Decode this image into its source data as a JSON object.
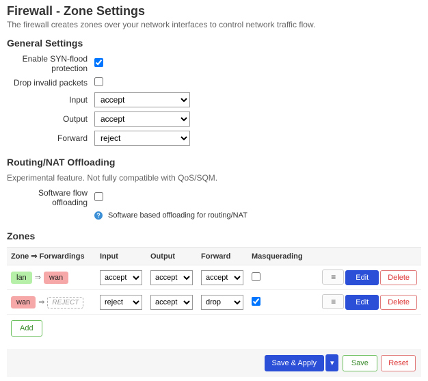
{
  "page": {
    "title": "Firewall - Zone Settings",
    "subtitle": "The firewall creates zones over your network interfaces to control network traffic flow."
  },
  "general": {
    "heading": "General Settings",
    "syn_flood_label": "Enable SYN-flood protection",
    "syn_flood_checked": true,
    "drop_invalid_label": "Drop invalid packets",
    "drop_invalid_checked": false,
    "input_label": "Input",
    "input_value": "accept",
    "output_label": "Output",
    "output_value": "accept",
    "forward_label": "Forward",
    "forward_value": "reject"
  },
  "offloading": {
    "heading": "Routing/NAT Offloading",
    "subtitle": "Experimental feature. Not fully compatible with QoS/SQM.",
    "software_label": "Software flow offloading",
    "software_checked": false,
    "hint": "Software based offloading for routing/NAT"
  },
  "zones": {
    "heading": "Zones",
    "columns": {
      "zone_fwd": "Zone ⇒ Forwardings",
      "input": "Input",
      "output": "Output",
      "forward": "Forward",
      "masq": "Masquerading"
    },
    "arrow": "⇒",
    "rows": [
      {
        "src": "lan",
        "src_color": "zone-lan",
        "dst": "wan",
        "dst_color": "zone-wan",
        "dst_is_reject": false,
        "input": "accept",
        "output": "accept",
        "forward": "accept",
        "masq": false
      },
      {
        "src": "wan",
        "src_color": "zone-wan",
        "dst": "REJECT",
        "dst_color": "zone-reject",
        "dst_is_reject": true,
        "input": "reject",
        "output": "accept",
        "forward": "drop",
        "masq": true
      }
    ],
    "action_labels": {
      "handle": "≡",
      "edit": "Edit",
      "delete": "Delete",
      "add": "Add"
    }
  },
  "footer": {
    "save_apply": "Save & Apply",
    "caret": "▾",
    "save": "Save",
    "reset": "Reset"
  },
  "select_options": {
    "policy": [
      "accept",
      "reject",
      "drop"
    ]
  }
}
